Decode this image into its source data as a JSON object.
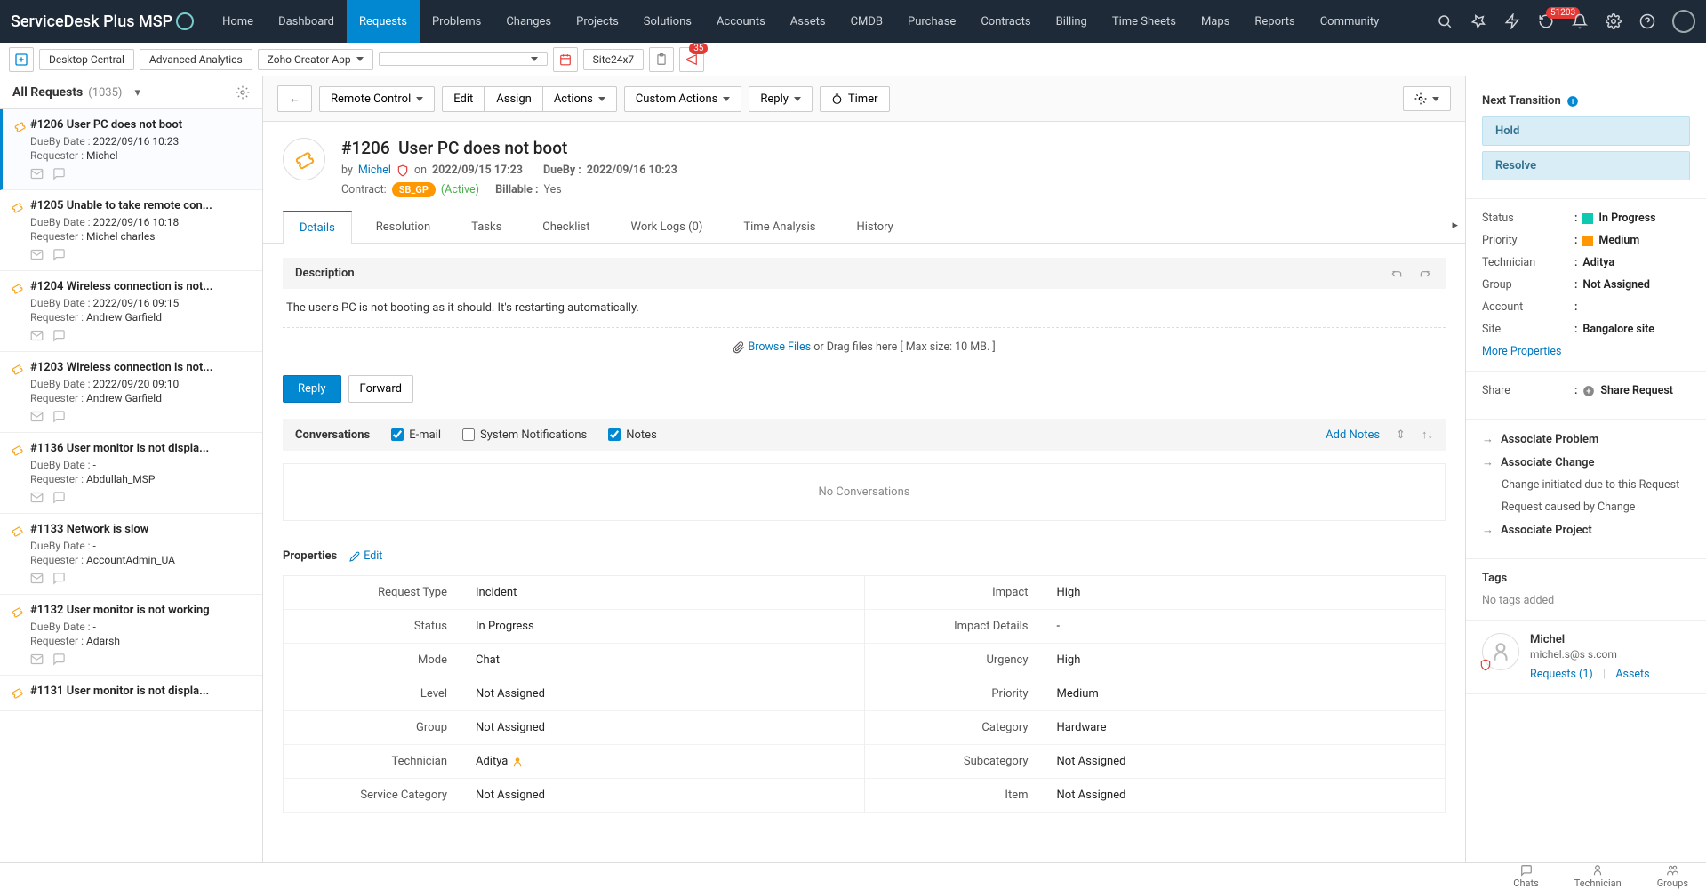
{
  "brand": "ServiceDesk Plus MSP",
  "nav": [
    "Home",
    "Dashboard",
    "Requests",
    "Problems",
    "Changes",
    "Projects",
    "Solutions",
    "Accounts",
    "Assets",
    "CMDB",
    "Purchase",
    "Contracts",
    "Billing",
    "Time Sheets",
    "Maps",
    "Reports",
    "Community"
  ],
  "nav_active": "Requests",
  "nav_badge": "51203",
  "subbar": {
    "desktop_central": "Desktop Central",
    "advanced_analytics": "Advanced Analytics",
    "zoho_creator": "Zoho Creator App",
    "site24x7": "Site24x7",
    "ann_badge": "35"
  },
  "list": {
    "title": "All Requests",
    "count": "(1035)",
    "items": [
      {
        "t": "#1206 User PC does not boot",
        "due": "2022/09/16 10:23",
        "req": "Michel",
        "active": true
      },
      {
        "t": "#1205 Unable to take remote con...",
        "due": "2022/09/16 10:18",
        "req": "Michel charles"
      },
      {
        "t": "#1204 Wireless connection is not...",
        "due": "2022/09/16 09:15",
        "req": "Andrew Garfield"
      },
      {
        "t": "#1203 Wireless connection is not...",
        "due": "2022/09/20 09:10",
        "req": "Andrew Garfield"
      },
      {
        "t": "#1136 User monitor is not displa...",
        "due": "-",
        "req": "Abdullah_MSP"
      },
      {
        "t": "#1133 Network is slow",
        "due": "-",
        "req": "AccountAdmin_UA"
      },
      {
        "t": "#1132 User monitor is not working",
        "due": "-",
        "req": "Adarsh"
      },
      {
        "t": "#1131 User monitor is not displa...",
        "due": "",
        "req": ""
      }
    ],
    "due_label": "DueBy Date :",
    "req_label": "Requester :"
  },
  "toolbar": {
    "back": "←",
    "remote": "Remote Control",
    "edit": "Edit",
    "assign": "Assign",
    "actions": "Actions",
    "custom": "Custom Actions",
    "reply": "Reply",
    "timer": "Timer"
  },
  "req": {
    "id": "#1206",
    "title": "User PC does not boot",
    "by_label": "by",
    "by": "Michel",
    "on_label": "on",
    "on": "2022/09/15 17:23",
    "dueby_label": "DueBy :",
    "dueby": "2022/09/16 10:23",
    "contract_label": "Contract:",
    "contract": "SB_GP",
    "contract_status": "(Active)",
    "billable_label": "Billable :",
    "billable": "Yes"
  },
  "tabs": [
    "Details",
    "Resolution",
    "Tasks",
    "Checklist",
    "Work Logs (0)",
    "Time Analysis",
    "History"
  ],
  "tabs_active": "Details",
  "desc": {
    "head": "Description",
    "text": "The user's PC is not booting as it should. It's restarting automatically."
  },
  "drop": {
    "browse": "Browse Files",
    "rest": " or Drag files here [ Max size: 10 MB. ]"
  },
  "actbtns": {
    "reply": "Reply",
    "forward": "Forward"
  },
  "conv": {
    "title": "Conversations",
    "email": "E-mail",
    "sys": "System Notifications",
    "notes": "Notes",
    "add": "Add Notes",
    "empty": "No Conversations"
  },
  "props": {
    "title": "Properties",
    "edit": "Edit",
    "left": [
      {
        "k": "Request Type",
        "v": "Incident"
      },
      {
        "k": "Status",
        "v": "In Progress"
      },
      {
        "k": "Mode",
        "v": "Chat"
      },
      {
        "k": "Level",
        "v": "Not Assigned"
      },
      {
        "k": "Group",
        "v": "Not Assigned"
      },
      {
        "k": "Technician",
        "v": "Aditya"
      },
      {
        "k": "Service Category",
        "v": "Not Assigned"
      }
    ],
    "right": [
      {
        "k": "Impact",
        "v": "High"
      },
      {
        "k": "Impact Details",
        "v": "-"
      },
      {
        "k": "Urgency",
        "v": "High"
      },
      {
        "k": "Priority",
        "v": "Medium"
      },
      {
        "k": "Category",
        "v": "Hardware"
      },
      {
        "k": "Subcategory",
        "v": "Not Assigned"
      },
      {
        "k": "Item",
        "v": "Not Assigned"
      }
    ]
  },
  "rp": {
    "next_trans": "Next Transition",
    "hold": "Hold",
    "resolve": "Resolve",
    "kv": [
      {
        "k": "Status",
        "v": "In Progress",
        "color": "teal"
      },
      {
        "k": "Priority",
        "v": "Medium",
        "color": "orange"
      },
      {
        "k": "Technician",
        "v": "Aditya"
      },
      {
        "k": "Group",
        "v": "Not Assigned"
      },
      {
        "k": "Account",
        "v": " "
      },
      {
        "k": "Site",
        "v": "Bangalore site"
      }
    ],
    "more": "More Properties",
    "share_k": "Share",
    "share_v": "Share Request",
    "assoc_problem": "Associate Problem",
    "assoc_change": "Associate Change",
    "change_init": "Change initiated due to this Request",
    "req_caused": "Request caused by Change",
    "assoc_project": "Associate Project",
    "tags": "Tags",
    "no_tags": "No tags added",
    "contact": {
      "name": "Michel",
      "email": "michel.s@s            s.com",
      "req_link": "Requests (1)",
      "assets_link": "Assets"
    }
  },
  "bottom": {
    "chats": "Chats",
    "tech": "Technician",
    "groups": "Groups"
  }
}
